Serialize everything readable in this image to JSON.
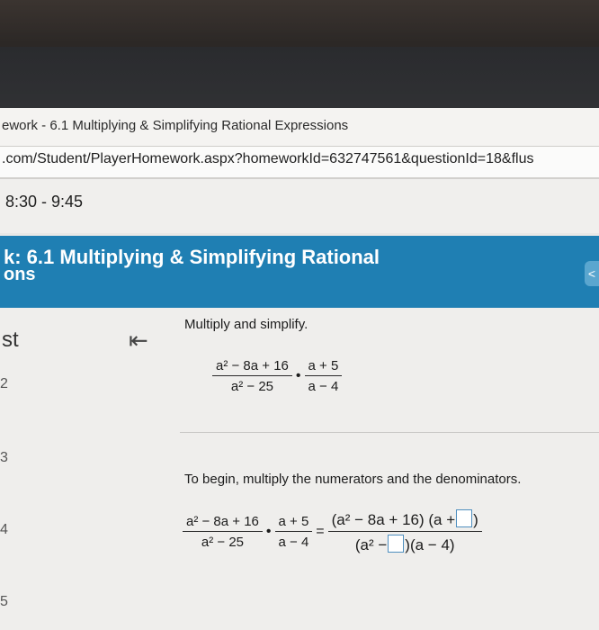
{
  "browser": {
    "tab_title": "ework - 6.1 Multiplying & Simplifying Rational Expressions",
    "url": ".com/Student/PlayerHomework.aspx?homeworkId=632747561&questionId=18&flus"
  },
  "schedule": {
    "time": "8:30 - 9:45"
  },
  "header": {
    "title_line1": "k: 6.1 Multiplying & Simplifying Rational",
    "title_line2": "ons",
    "collapse_glyph": "<"
  },
  "sidebar": {
    "label": "st",
    "collapse_glyph": "⇤",
    "numbers": [
      "2",
      "3",
      "4",
      "5"
    ]
  },
  "question": {
    "instruction": "Multiply and simplify.",
    "problem": {
      "frac1_num": "a² − 8a + 16",
      "frac1_den": "a² − 25",
      "dot": "•",
      "frac2_num": "a + 5",
      "frac2_den": "a − 4"
    },
    "step": {
      "text": "To begin, multiply the numerators and the denominators.",
      "equals": "=",
      "rhs_num_part1": "(a² − 8a + 16) (a +",
      "rhs_num_part2": ")",
      "rhs_den_part1": "(a² −",
      "rhs_den_part2": ")(a − 4)"
    }
  },
  "colors": {
    "header_blue": "#1f7fb3",
    "answer_box_border": "#4f8fbf"
  }
}
